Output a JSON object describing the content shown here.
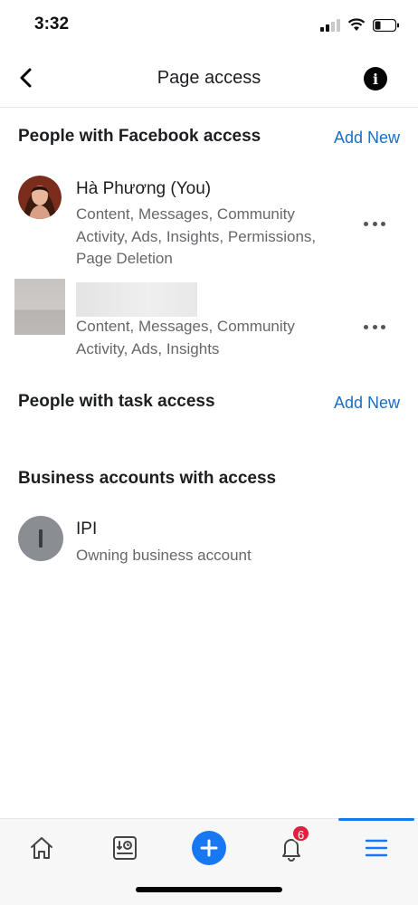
{
  "status_bar": {
    "time": "3:32",
    "icons": [
      "signal-icon",
      "wifi-icon",
      "battery-icon"
    ]
  },
  "header": {
    "title": "Page access",
    "back_icon": "chevron-left-icon",
    "info_icon": "info-icon",
    "info_glyph": "i"
  },
  "facebook_access": {
    "title": "People with Facebook access",
    "add_label": "Add New",
    "people": [
      {
        "name": "Hà Phương (You)",
        "permissions": "Content, Messages, Community Activity, Ads, Insights, Permissions, Page Deletion"
      },
      {
        "name": "",
        "permissions": "Content, Messages, Community Activity, Ads, Insights"
      }
    ]
  },
  "task_access": {
    "title": "People with task access",
    "add_label": "Add New"
  },
  "business_access": {
    "title": "Business accounts with access",
    "accounts": [
      {
        "name": "IPI",
        "role": "Owning business account"
      }
    ]
  },
  "tab_bar": {
    "tabs": [
      "home-icon",
      "insights-icon",
      "create-icon",
      "notifications-icon",
      "menu-icon"
    ],
    "notification_count": "6",
    "active_tab": "menu-icon"
  },
  "colors": {
    "link": "#1b6ec2",
    "accent": "#1877f2",
    "badge": "#e41e3f",
    "secondary_text": "#65676b"
  }
}
